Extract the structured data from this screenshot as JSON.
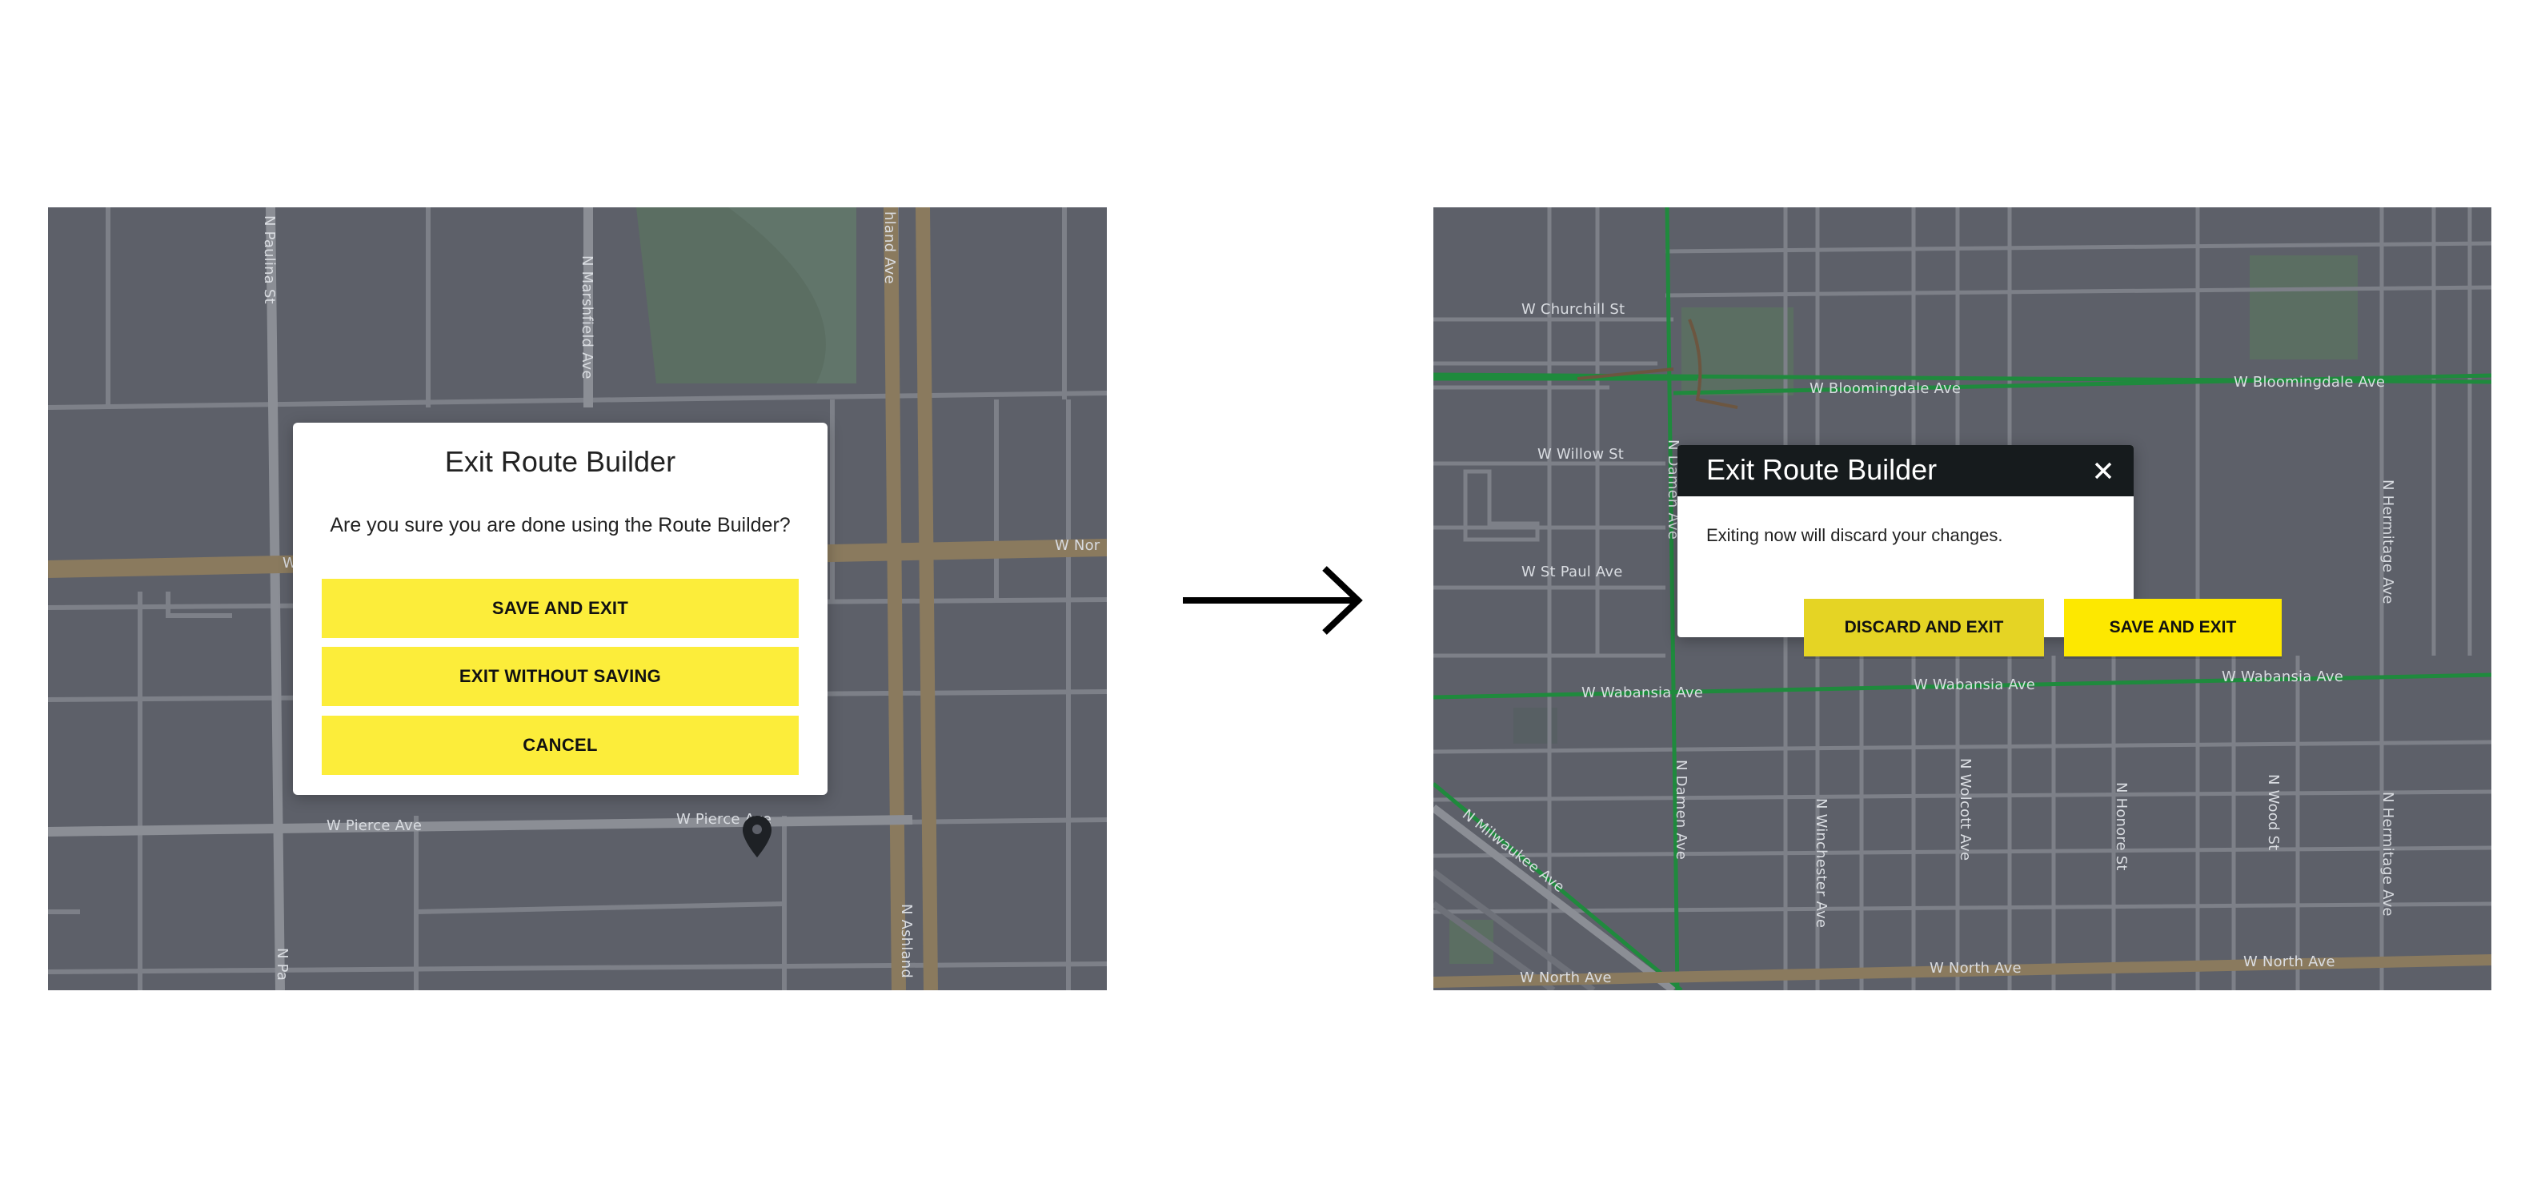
{
  "left_screen": {
    "modal": {
      "title": "Exit Route Builder",
      "message": "Are you sure you are done using the Route Builder?",
      "buttons": {
        "save_and_exit": "SAVE AND EXIT",
        "exit_without_saving": "EXIT WITHOUT SAVING",
        "cancel": "CANCEL"
      }
    },
    "map_labels": {
      "paulina_top": "N Paulina St",
      "marshfield": "N Marshfield Ave",
      "ashland_top": "hland Ave",
      "north_ave_right": "W Nor",
      "north_ave_left": "W",
      "pierce_left": "W Pierce Ave",
      "pierce_right": "W Pierce Ave",
      "paulina_bottom": "N Pa",
      "ashland_bottom": "N Ashland"
    }
  },
  "transition": {
    "arrow_icon": "right-arrow-icon"
  },
  "right_screen": {
    "modal": {
      "title": "Exit Route Builder",
      "message": "Exiting now will discard your changes.",
      "buttons": {
        "discard_and_exit": "DISCARD AND EXIT",
        "save_and_exit": "SAVE AND EXIT"
      },
      "close_icon": "close-icon"
    },
    "map_labels": {
      "churchill": "W Churchill St",
      "bloomingdale_1": "W Bloomingdale Ave",
      "bloomingdale_2": "W Bloomingdale Ave",
      "willow": "W Willow St",
      "st_paul": "W St Paul Ave",
      "damen_top": "N Damen Ave",
      "hermitage_top": "N Hermitage Ave",
      "wabansia_1": "W Wabansia Ave",
      "wabansia_2": "W Wabansia Ave",
      "wabansia_3": "W Wabansia Ave",
      "milwaukee": "N Milwaukee Ave",
      "damen_bottom": "N Damen Ave",
      "winchester": "N Winchester Ave",
      "wolcott": "N Wolcott Ave",
      "honore": "N Honore St",
      "wood": "N Wood St",
      "hermitage_bottom": "N Hermitage Ave",
      "north_ave_1": "W North Ave",
      "north_ave_2": "W North Ave",
      "north_ave_3": "W North Ave"
    }
  },
  "colors": {
    "map_background": "#5d6069",
    "map_street": "#7d8088",
    "arterial": "#8a7a5e",
    "park": "#5b6e62",
    "bike_route": "#1f8a3d",
    "button_yellow": "#fced3a",
    "button_discard": "#e5d424",
    "button_save_right": "#fde800",
    "dark_header": "#161b1d"
  }
}
